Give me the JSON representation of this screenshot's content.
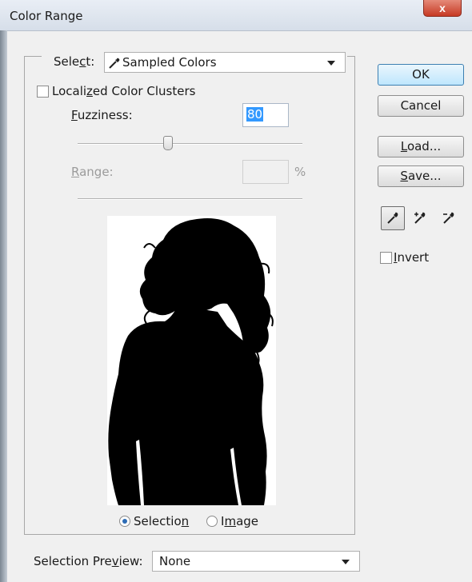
{
  "window": {
    "title": "Color Range",
    "close_glyph": "x"
  },
  "select": {
    "prefix": "Sele",
    "accesskey": "c",
    "suffix": "t:",
    "icon": "eyedropper-icon",
    "value": "Sampled Colors"
  },
  "localized": {
    "prefix": "Locali",
    "accesskey": "z",
    "suffix": "ed Color Clusters",
    "checked": false
  },
  "fuzziness": {
    "accesskey": "F",
    "suffix": "uzziness:",
    "value": "80"
  },
  "range": {
    "accesskey": "R",
    "suffix": "ange:",
    "value": "",
    "unit": "%",
    "enabled": false
  },
  "buttons": {
    "ok": "OK",
    "cancel": "Cancel",
    "load_key": "L",
    "load_rest": "oad...",
    "save_key": "S",
    "save_rest": "ave..."
  },
  "tools": [
    "eyedropper-icon",
    "eyedropper-plus-icon",
    "eyedropper-minus-icon"
  ],
  "invert": {
    "accesskey": "I",
    "suffix": "nvert",
    "checked": false
  },
  "view": {
    "selection_prefix": "Selectio",
    "selection_key": "n",
    "image_prefix": "I",
    "image_key": "m",
    "image_suffix": "age",
    "selected": "Selection"
  },
  "preview_mode": {
    "prefix": "Selection Pre",
    "accesskey": "v",
    "suffix": "iew:",
    "value": "None"
  },
  "colors": {
    "accent_blue": "#3399ff",
    "default_button": "#bee6fd",
    "close_red": "#c63a24"
  }
}
